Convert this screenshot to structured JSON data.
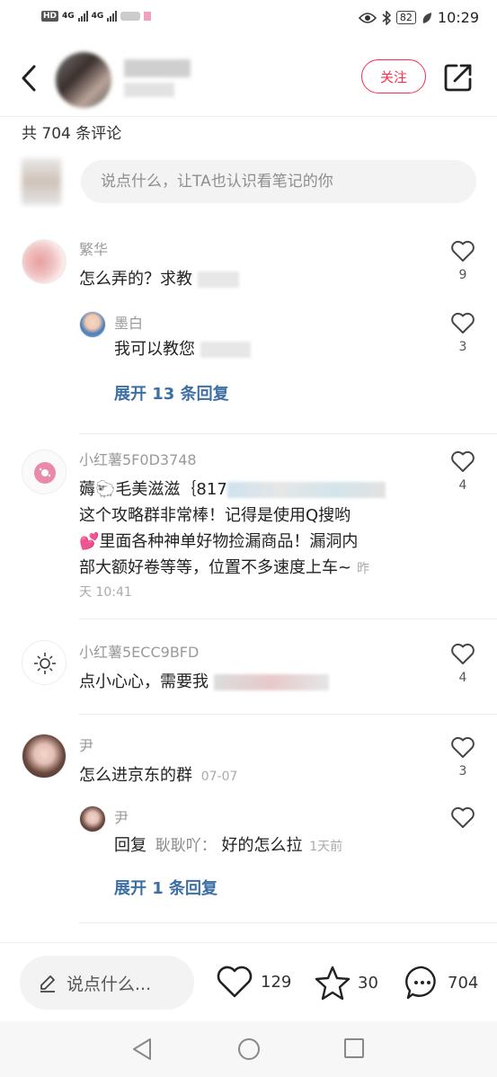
{
  "status_bar": {
    "hd": "HD",
    "network1": "4G",
    "network2": "4G",
    "battery": "82",
    "time": "10:29"
  },
  "header": {
    "follow_label": "关注"
  },
  "comment_count_label": "共 704 条评论",
  "composer": {
    "placeholder": "说点什么，让TA也认识看笔记的你"
  },
  "comments": [
    {
      "username": "繁华",
      "text": "怎么弄的？求教",
      "likes": "9",
      "reply": {
        "username": "墨白",
        "text": "我可以教您",
        "likes": "3"
      },
      "expand_label": "展开 13 条回复"
    },
    {
      "username": "小红薯5F0D3748",
      "text_line1": "薅🐑毛美滋滋｛817",
      "text_line2": "这个攻略群非常棒！记得是使用Q搜哟",
      "text_line3": "💕里面各种神单好物捡漏商品！漏洞内",
      "text_line4": "部大额好卷等等，位置不多速度上车~",
      "meta_inline": "昨",
      "meta_next": "天 10:41",
      "likes": "4"
    },
    {
      "username": "小红薯5ECC9BFD",
      "text": "点小心心，需要我",
      "likes": "4"
    },
    {
      "username": "尹",
      "text": "怎么进京东的群",
      "date": "07-07",
      "likes": "3",
      "reply": {
        "username": "尹",
        "reply_prefix": "回复",
        "reply_to": "耿耿吖：",
        "text": "好的怎么拉",
        "date": "1天前",
        "likes": ""
      },
      "expand_label": "展开 1 条回复"
    }
  ],
  "bottom_bar": {
    "input_placeholder": "说点什么...",
    "likes": "129",
    "stars": "30",
    "comments": "704"
  },
  "colors": {
    "accent_red": "#ff2e4d",
    "link_blue": "#3d6fa5"
  }
}
